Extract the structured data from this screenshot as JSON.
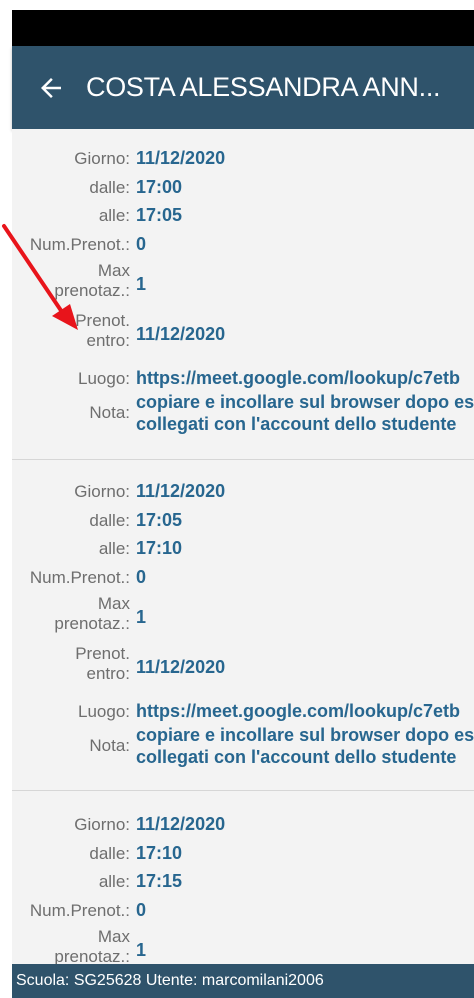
{
  "app": {
    "title": "COSTA ALESSANDRA ANN..."
  },
  "labels": {
    "giorno": "Giorno:",
    "dalle": "dalle:",
    "alle": "alle:",
    "num_prenot": "Num.Prenot.:",
    "max_line1": "Max",
    "max_line2": "prenotaz.:",
    "prenot_line1": "Prenot.",
    "prenot_line2": "entro:",
    "luogo": "Luogo:",
    "nota": "Nota:"
  },
  "slots": [
    {
      "giorno": "11/12/2020",
      "dalle": "17:00",
      "alle": "17:05",
      "num_prenot": "0",
      "max_prenotaz": "1",
      "prenot_entro": "11/12/2020",
      "luogo": "https://meet.google.com/lookup/c7etb",
      "nota_line1": "copiare e incollare sul browser dopo es",
      "nota_line2": "collegati con l'account dello studente"
    },
    {
      "giorno": "11/12/2020",
      "dalle": "17:05",
      "alle": "17:10",
      "num_prenot": "0",
      "max_prenotaz": "1",
      "prenot_entro": "11/12/2020",
      "luogo": "https://meet.google.com/lookup/c7etb",
      "nota_line1": "copiare e incollare sul browser dopo es",
      "nota_line2": "collegati con l'account dello studente"
    },
    {
      "giorno": "11/12/2020",
      "dalle": "17:10",
      "alle": "17:15",
      "num_prenot": "0",
      "max_prenotaz": "1"
    }
  ],
  "footer": {
    "text": "Scuola: SG25628 Utente: marcomilani2006"
  },
  "colors": {
    "appbar": "#2f536b",
    "value_text": "#27668f",
    "label_text": "#6e6e6e",
    "annotation_arrow": "#e8141b"
  },
  "icons": {
    "back": "back-arrow-icon"
  }
}
